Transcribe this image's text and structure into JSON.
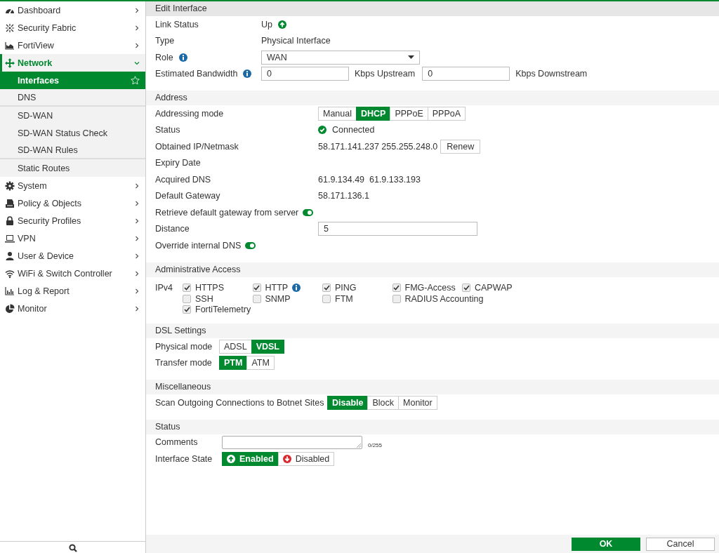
{
  "sidebar": {
    "items": [
      {
        "label": "Dashboard",
        "selected": false,
        "expanded": false
      },
      {
        "label": "Security Fabric",
        "selected": false,
        "expanded": false
      },
      {
        "label": "FortiView",
        "selected": false,
        "expanded": false
      },
      {
        "label": "Network",
        "selected": true,
        "expanded": true,
        "children": [
          {
            "label": "Interfaces",
            "selected": true,
            "divider_after": false
          },
          {
            "label": "DNS",
            "selected": false,
            "divider_after": true
          },
          {
            "label": "SD-WAN",
            "selected": false,
            "divider_after": false
          },
          {
            "label": "SD-WAN Status Check",
            "selected": false,
            "divider_after": false
          },
          {
            "label": "SD-WAN Rules",
            "selected": false,
            "divider_after": true
          },
          {
            "label": "Static Routes",
            "selected": false,
            "divider_after": false
          }
        ]
      },
      {
        "label": "System",
        "selected": false,
        "expanded": false
      },
      {
        "label": "Policy & Objects",
        "selected": false,
        "expanded": false
      },
      {
        "label": "Security Profiles",
        "selected": false,
        "expanded": false
      },
      {
        "label": "VPN",
        "selected": false,
        "expanded": false
      },
      {
        "label": "User & Device",
        "selected": false,
        "expanded": false
      },
      {
        "label": "WiFi & Switch Controller",
        "selected": false,
        "expanded": false
      },
      {
        "label": "Log & Report",
        "selected": false,
        "expanded": false
      },
      {
        "label": "Monitor",
        "selected": false,
        "expanded": false
      }
    ]
  },
  "sections": [
    {
      "title": "Edit Interface",
      "rows": [
        {
          "kind": "text",
          "label": "Link Status",
          "value": "Up",
          "link_up": true
        },
        {
          "kind": "text",
          "label": "Type",
          "value": "Physical Interface"
        },
        {
          "kind": "select",
          "label": "Role",
          "info": true,
          "value": "WAN"
        },
        {
          "kind": "bandwidth",
          "label": "Estimated Bandwidth",
          "info": true,
          "fields": [
            {
              "value": "0",
              "unit": "Kbps Upstream"
            },
            {
              "value": "0",
              "unit": "Kbps Downstream"
            }
          ]
        }
      ]
    },
    {
      "title": "Address",
      "rows": [
        {
          "kind": "segmented",
          "label": "Addressing mode",
          "options": [
            {
              "label": "Manual",
              "selected": false
            },
            {
              "label": "DHCP",
              "selected": true
            },
            {
              "label": "PPPoE",
              "selected": false
            },
            {
              "label": "PPPoA",
              "selected": false
            }
          ]
        },
        {
          "kind": "status",
          "label": "Status",
          "value": "Connected",
          "ok": true
        },
        {
          "kind": "text_button",
          "label": "Obtained IP/Netmask",
          "value": "58.171.141.237 255.255.248.0",
          "button": "Renew"
        },
        {
          "kind": "text",
          "label": "Expiry Date"
        },
        {
          "kind": "text",
          "label": "Acquired DNS",
          "value": "61.9.134.49  61.9.133.193"
        },
        {
          "kind": "text",
          "label": "Default Gateway",
          "value": "58.171.136.1"
        },
        {
          "kind": "toggle",
          "label": "Retrieve default gateway from server",
          "on": true
        },
        {
          "kind": "input",
          "label": "Distance",
          "value": "5"
        },
        {
          "kind": "toggle",
          "label": "Override internal DNS",
          "on": true
        }
      ]
    },
    {
      "title": "Administrative Access",
      "rows": [
        {
          "kind": "checkgrid",
          "label": "IPv4",
          "columns": [
            [
              {
                "label": "HTTPS",
                "checked": true
              },
              {
                "label": "SSH",
                "checked": false
              },
              {
                "label": "FortiTelemetry",
                "checked": true
              }
            ],
            [
              {
                "label": "HTTP",
                "checked": true,
                "info": true
              },
              {
                "label": "SNMP",
                "checked": false
              }
            ],
            [
              {
                "label": "PING",
                "checked": true
              },
              {
                "label": "FTM",
                "checked": false
              }
            ],
            [
              {
                "label": "FMG-Access",
                "checked": true
              },
              {
                "label": "RADIUS Accounting",
                "checked": false
              }
            ],
            [
              {
                "label": "CAPWAP",
                "checked": true
              }
            ]
          ]
        }
      ]
    },
    {
      "title": "DSL Settings",
      "rows": [
        {
          "kind": "segmented",
          "label": "Physical mode",
          "options": [
            {
              "label": "ADSL",
              "selected": false
            },
            {
              "label": "VDSL",
              "selected": true
            }
          ]
        },
        {
          "kind": "segmented",
          "label": "Transfer mode",
          "options": [
            {
              "label": "PTM",
              "selected": true
            },
            {
              "label": "ATM",
              "selected": false
            }
          ]
        }
      ]
    },
    {
      "title": "Miscellaneous",
      "rows": [
        {
          "kind": "segmented",
          "label": "Scan Outgoing Connections to Botnet Sites",
          "options": [
            {
              "label": "Disable",
              "selected": true
            },
            {
              "label": "Block",
              "selected": false
            },
            {
              "label": "Monitor",
              "selected": false
            }
          ]
        }
      ]
    },
    {
      "title": "Status",
      "rows": [
        {
          "kind": "textarea",
          "label": "Comments",
          "counter": "0/255"
        },
        {
          "kind": "updown",
          "label": "Interface State",
          "options": [
            {
              "label": "Enabled",
              "selected": true
            },
            {
              "label": "Disabled",
              "selected": false
            }
          ]
        }
      ]
    }
  ],
  "footer": {
    "buttons": [
      {
        "label": "OK",
        "primary": true
      },
      {
        "label": "Cancel",
        "primary": false
      }
    ]
  }
}
